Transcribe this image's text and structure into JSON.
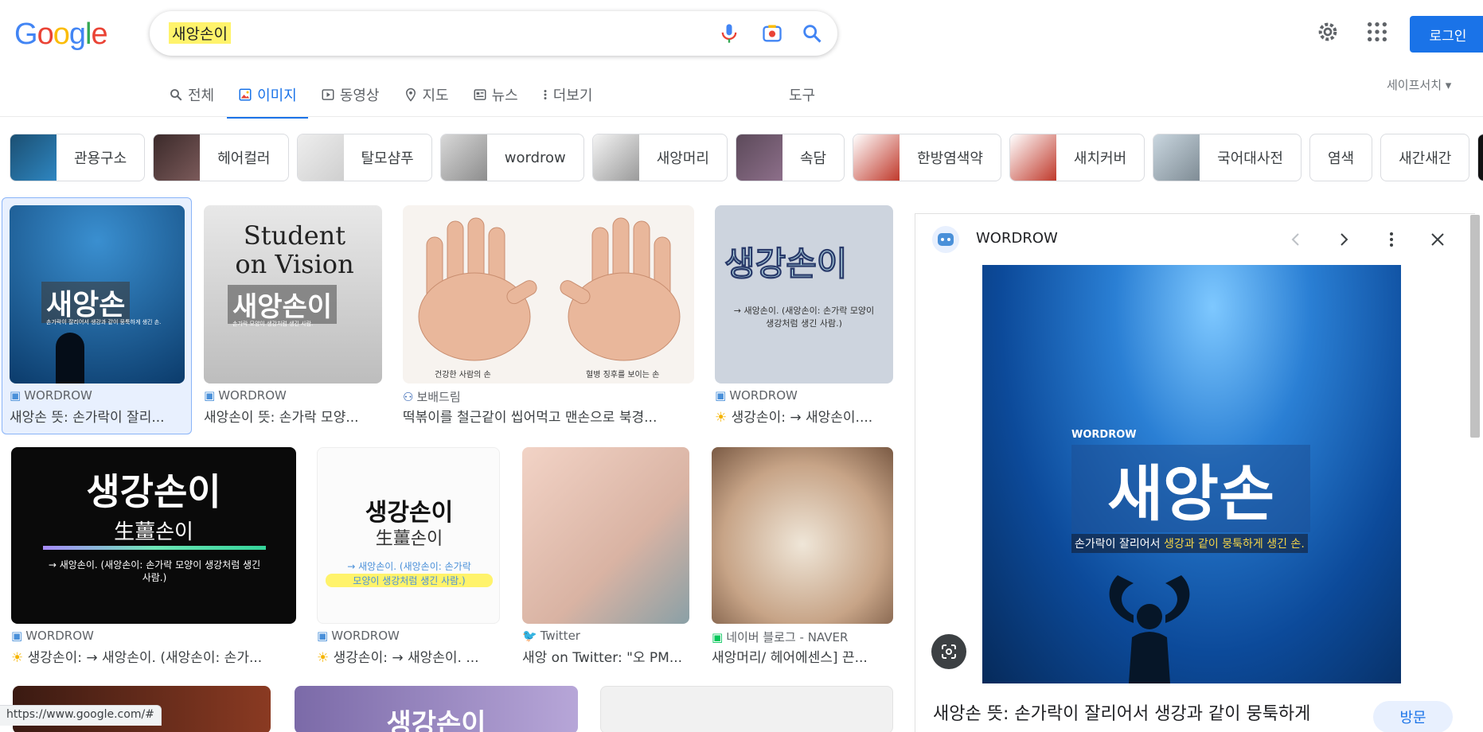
{
  "header": {
    "search_query": "새앙손이",
    "login_label": "로그인"
  },
  "tabs": [
    {
      "label": "전체",
      "icon": "search-icon"
    },
    {
      "label": "이미지",
      "icon": "image-icon",
      "active": true
    },
    {
      "label": "동영상",
      "icon": "video-icon"
    },
    {
      "label": "지도",
      "icon": "map-pin-icon"
    },
    {
      "label": "뉴스",
      "icon": "news-icon"
    },
    {
      "label": "더보기",
      "icon": "more-vert-icon"
    }
  ],
  "tools_label": "도구",
  "safesearch_label": "세이프서치",
  "chips": [
    "관용구소",
    "헤어컬러",
    "탈모샴푸",
    "wordrow",
    "새앙머리",
    "속담",
    "한방염색약",
    "새치커버",
    "국어대사전",
    "염색",
    "새간새간"
  ],
  "results": [
    {
      "source": "WORDROW",
      "title": "새앙손 뜻: 손가락이 잘리..."
    },
    {
      "source": "WORDROW",
      "title": "새앙손이 뜻: 손가락 모양..."
    },
    {
      "source": "보배드림",
      "title": "떡볶이를 철근같이 씹어먹고 맨손으로 북경..."
    },
    {
      "source": "WORDROW",
      "title": "생강손이: → 새앙손이...."
    },
    {
      "source": "WORDROW",
      "title": "생강손이: → 새앙손이. (새앙손이: 손가..."
    },
    {
      "source": "WORDROW",
      "title": "생강손이: → 새앙손이. ..."
    },
    {
      "source": "Twitter",
      "title": "새앙 on Twitter: \"오 PM..."
    },
    {
      "source": "네이버 블로그 - NAVER",
      "title": "새앙머리/ 헤어에센스] 끈..."
    }
  ],
  "image_text": {
    "r1": "새앙손",
    "r1_sub": "손가락이 잘리어서 생강과 같이 뭉툭하게 생긴 손.",
    "r2_top": "Student on Vision",
    "r2": "새앙손이",
    "r2_sub": "손가락 모양이 생강처럼 생긴 사람.",
    "r3_left": "건강한 사람의 손",
    "r3_right": "혈병 징후를 보이는 손",
    "r4": "생강손이",
    "r4_sub1": "→ 새앙손이. (새앙손이: 손가락 모양이",
    "r4_sub2": "생강처럼 생긴 사람.)",
    "r5": "생강손이",
    "r5_han": "生薑손이",
    "r5_sub": "→ 새앙손이. (새앙손이: 손가락 모양이 생강처럼 생긴 사람.)",
    "r6": "생강손이",
    "r6_han": "生薑손이",
    "r6_sub1": "→ 새앙손이. (새앙손이: 손가락",
    "r6_sub2": "모양이 생강처럼 생긴 사람.)",
    "bottom2": "생강손이"
  },
  "panel": {
    "site": "WORDROW",
    "image_word": "새앙손",
    "image_brand": "WORDROW",
    "image_caption_a": "손가락이 잘리어서 ",
    "image_caption_b": "생강과 같이 뭉툭하게 생긴 손.",
    "title": "새앙손 뜻: 손가락이 잘리어서 생강과 같이 뭉툭하게",
    "visit_label": "방문"
  },
  "status_url": "https://www.google.com/#"
}
